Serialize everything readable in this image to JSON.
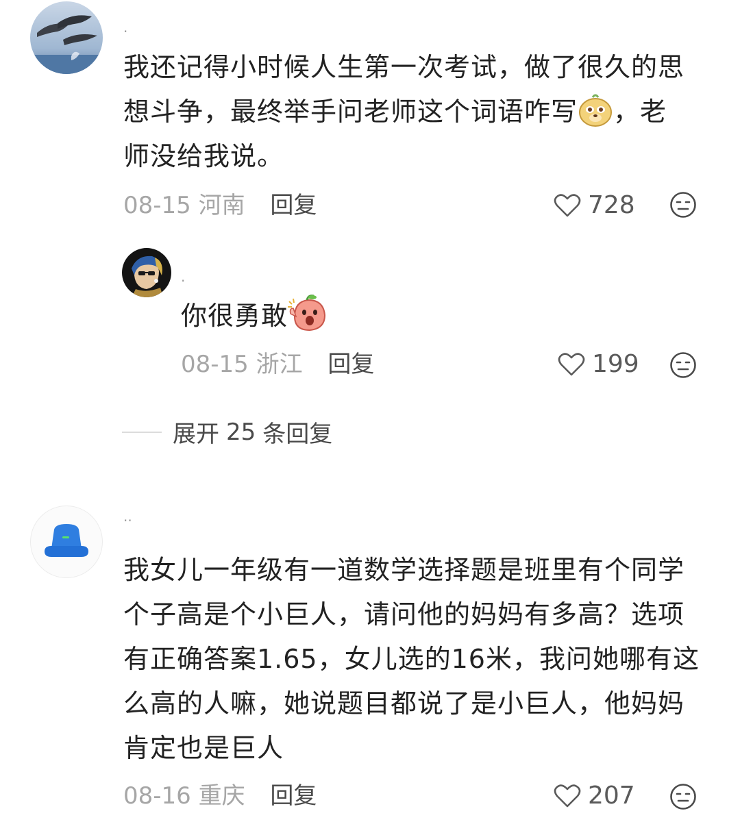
{
  "comments": [
    {
      "username": "·",
      "text_line1": "我还记得小时候人生第一次考试，做了很久的思",
      "text_line2a": "想斗争，最终举手问老师这个词语咋写",
      "text_line2b": "，老",
      "text_line3": "师没给我说。",
      "emoji": "dog-face-emoji",
      "date": "08-15",
      "location": "河南",
      "reply_label": "回复",
      "likes": "728"
    },
    {
      "username": "·",
      "text": "你很勇敢",
      "emoji": "peach-cheer-emoji",
      "date": "08-15",
      "location": "浙江",
      "reply_label": "回复",
      "likes": "199"
    },
    {
      "username": "··",
      "text_lines": [
        "我女儿一年级有一道数学选择题是班里有个同学",
        "个子高是个小巨人，请问他的妈妈有多高？选项",
        "有正确答案1.65，女儿选的16米，我问她哪有这",
        "么高的人嘛，她说题目都说了是小巨人，他妈妈",
        "肯定也是巨人"
      ],
      "date": "08-16",
      "location": "重庆",
      "reply_label": "回复",
      "likes": "207"
    }
  ],
  "expand": {
    "prefix": "展开",
    "count": "25",
    "suffix": "条回复"
  },
  "icons": {
    "like": "heart-outline-icon",
    "more": "meh-face-icon"
  }
}
